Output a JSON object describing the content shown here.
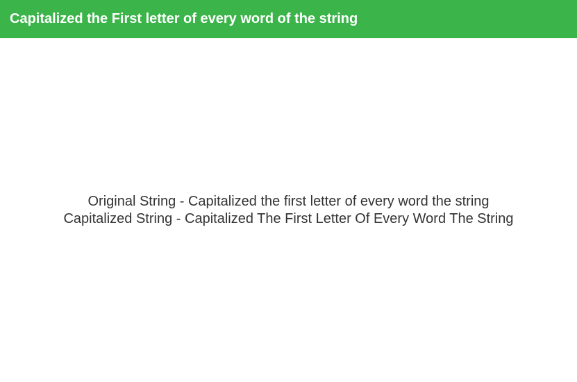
{
  "header": {
    "title": "Capitalized the First letter of every word of the string"
  },
  "content": {
    "original": {
      "label": "Original String",
      "separator": " - ",
      "value": "Capitalized the first letter of every word the string"
    },
    "capitalized": {
      "label": "Capitalized String",
      "separator": " - ",
      "value": "Capitalized The First Letter Of Every Word The String"
    }
  }
}
